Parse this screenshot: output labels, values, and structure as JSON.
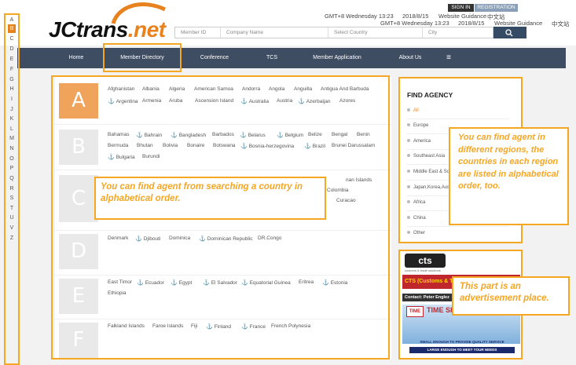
{
  "header": {
    "logo_text": "JCtrans",
    "logo_suffix": ".net",
    "time_row1": "GMT+8 Wednesday 13:23",
    "date_row1": "2018/8/15",
    "guidance_row1": "Website Guidance",
    "lang_row1": "中文站",
    "time_row2": "GMT+8 Wednesday 13:23",
    "date_row2": "2018/8/15",
    "guidance_row2": "Website Guidance",
    "lang_row2": "中文站",
    "sign_in": "SIGN IN",
    "registration": "REGISTRATION"
  },
  "search": {
    "member_id": "Member ID",
    "company_name": "Company Name",
    "select_country": "Select Country",
    "city": "City"
  },
  "nav": {
    "home": "Home",
    "member_directory": "Member Directory",
    "conference": "Conference",
    "tcs": "TCS",
    "member_application": "Member Application",
    "about_us": "About Us",
    "menu_icon": "≡"
  },
  "alphabet": [
    "A",
    "B",
    "C",
    "D",
    "E",
    "F",
    "G",
    "H",
    "I",
    "J",
    "K",
    "L",
    "M",
    "N",
    "O",
    "P",
    "Q",
    "R",
    "S",
    "T",
    "U",
    "V",
    "Z"
  ],
  "sections": {
    "A": {
      "letter": "A",
      "row1": [
        "Afghanistan",
        "Albania",
        "Algeria",
        "American Samoa",
        "Andorra",
        "Angola",
        "Anguilla",
        "Antigua And Barbuda"
      ],
      "row2": [
        "Argentina",
        "Armenia",
        "Aruba",
        "Ascension Island",
        "Australia",
        "Austria",
        "Azerbaijan",
        "Azores"
      ]
    },
    "B": {
      "letter": "B",
      "row1": [
        "Bahamas",
        "Bahrain",
        "Bangladesh",
        "Barbados",
        "Belarus",
        "Belgium",
        "Belize",
        "Bengal",
        "Benin"
      ],
      "row2": [
        "Bermuda",
        "Bhutan",
        "Bolivia",
        "Bonaire",
        "Botswana",
        "Bosnia-herzegovina",
        "Brazil",
        "Brunei Darussalam"
      ],
      "row3": [
        "Bulgaria",
        "Burundi"
      ]
    },
    "C": {
      "letter": "C",
      "partial1": "nan Islands",
      "partial2": "Colombia",
      "partial3": "Curacao"
    },
    "D": {
      "letter": "D",
      "row1": [
        "Denmark",
        "Djibouti",
        "Dominica",
        "Dominican Republic",
        "DR.Congo"
      ]
    },
    "E": {
      "letter": "E",
      "row1": [
        "East Timor",
        "Ecuador",
        "Egypt",
        "El Salvador",
        "Equatorial Guinea",
        "Eritrea",
        "Estonia"
      ],
      "row2": [
        "Ethiopia"
      ]
    },
    "F": {
      "letter": "F",
      "row1": [
        "Falkland Islands",
        "Faroe Islands",
        "Fiji",
        "Finland",
        "France",
        "French Polynesia"
      ]
    }
  },
  "find_agency": {
    "title": "FIND AGENCY",
    "regions": [
      "All",
      "Europe",
      "America",
      "Southeast Asia",
      "Middle East & So",
      "Japan,Korea,Aus",
      "Africa",
      "China",
      "Other"
    ]
  },
  "callouts": {
    "search": "You can find agent from searching a country in alphabetical order.",
    "regions": "You can find agent in different regions, the countries in each region are listed in alphabetical order, too.",
    "ad": "This part is an advertisement place."
  },
  "ad": {
    "cts_logo": "cts",
    "cts_tag": "customs & trade solutions",
    "cts_banner": "CTS (Customs & T",
    "contact": "Contact: Peter Englez",
    "time_shipping": "TIME SHIPPING Srl",
    "slogan1": "SMALL ENOUGH TO PROVIDE QUALITY SERVICE",
    "slogan2": "LARGE ENOUGH TO MEET YOUR NEEDS"
  },
  "colors": {
    "accent": "#f5a623",
    "nav_bg": "#3f4d63",
    "letter_active": "#f0a35a"
  }
}
